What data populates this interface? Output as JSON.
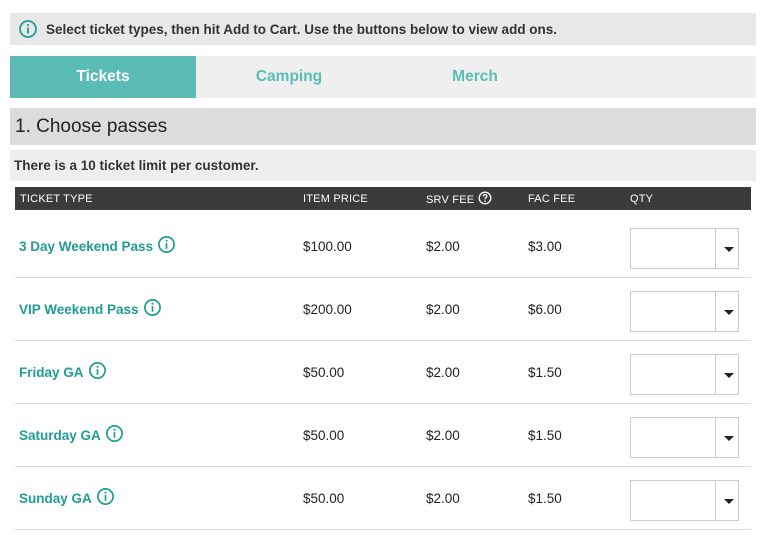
{
  "info_bar": {
    "icon": "info-circle-icon",
    "text": "Select ticket types, then hit Add to Cart. Use the buttons below to view add ons."
  },
  "tabs": [
    {
      "label": "Tickets",
      "active": true
    },
    {
      "label": "Camping",
      "active": false
    },
    {
      "label": "Merch",
      "active": false
    }
  ],
  "section": {
    "title": "1. Choose passes",
    "limit_note": "There is a 10 ticket limit per customer."
  },
  "table": {
    "headers": {
      "ticket_type": "TICKET TYPE",
      "item_price": "ITEM PRICE",
      "srv_fee": "SRV FEE",
      "fac_fee": "FAC FEE",
      "qty": "QTY"
    },
    "rows": [
      {
        "name": "3 Day Weekend Pass",
        "price": "$100.00",
        "srv_fee": "$2.00",
        "fac_fee": "$3.00",
        "qty": ""
      },
      {
        "name": "VIP Weekend Pass",
        "price": "$200.00",
        "srv_fee": "$2.00",
        "fac_fee": "$6.00",
        "qty": ""
      },
      {
        "name": "Friday GA",
        "price": "$50.00",
        "srv_fee": "$2.00",
        "fac_fee": "$1.50",
        "qty": ""
      },
      {
        "name": "Saturday GA",
        "price": "$50.00",
        "srv_fee": "$2.00",
        "fac_fee": "$1.50",
        "qty": ""
      },
      {
        "name": "Sunday GA",
        "price": "$50.00",
        "srv_fee": "$2.00",
        "fac_fee": "$1.50",
        "qty": ""
      }
    ]
  },
  "colors": {
    "accent": "#5bbcb5",
    "link": "#1f9c94",
    "header_bg": "#3b3b3b"
  }
}
